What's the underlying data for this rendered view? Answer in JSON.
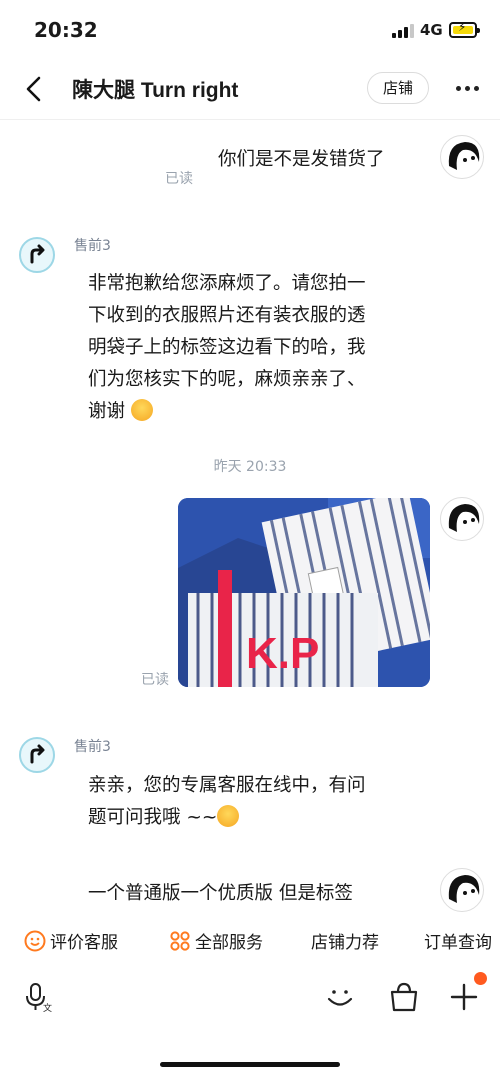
{
  "status_bar": {
    "time": "20:32",
    "network": "4G"
  },
  "header": {
    "title": "陳大腿 Turn right",
    "shop_button": "店铺"
  },
  "messages": [
    {
      "from": "me",
      "text": "你们是不是发错货了",
      "read": "已读"
    },
    {
      "from": "seller",
      "seller_name": "售前3",
      "lines": [
        "非常抱歉给您添麻烦了。请您拍一",
        "下收到的衣服照片还有装衣服的透",
        "明袋子上的标签这边看下的哈，我",
        "们为您核实下的呢，麻烦亲亲了、",
        "谢谢"
      ]
    },
    {
      "type": "time",
      "text": "昨天 20:33"
    },
    {
      "from": "me",
      "type": "image",
      "read": "已读",
      "image_text": "K.P"
    },
    {
      "from": "seller",
      "seller_name": "售前3",
      "lines": [
        "亲亲，您的专属客服在线中，有问",
        "题可问我哦 ~~"
      ]
    },
    {
      "from": "me",
      "text": "一个普通版一个优质版 但是标签"
    }
  ],
  "quick_actions": [
    "评价客服",
    "全部服务",
    "店铺力荐",
    "订单查询"
  ],
  "colors": {
    "accent_orange": "#ff7a1f",
    "seller_avatar": "#9dd7e6",
    "badge": "#ff5a1f"
  }
}
